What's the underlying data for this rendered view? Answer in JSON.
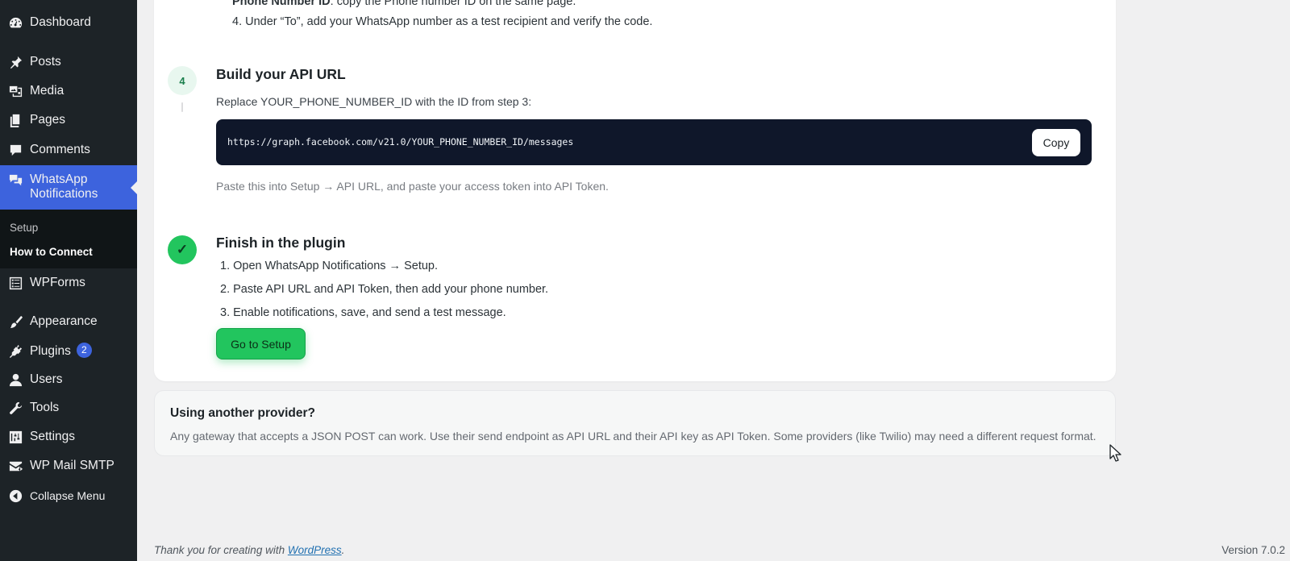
{
  "sidebar": {
    "items": [
      {
        "label": "Dashboard",
        "icon": "dashboard-icon"
      },
      {
        "label": "Posts",
        "icon": "pin-icon"
      },
      {
        "label": "Media",
        "icon": "media-icon"
      },
      {
        "label": "Pages",
        "icon": "pages-icon"
      },
      {
        "label": "Comments",
        "icon": "comment-icon"
      },
      {
        "label": "WhatsApp\nNotifications",
        "icon": "chat-bubbles-icon"
      },
      {
        "label": "WPForms",
        "icon": "form-icon"
      },
      {
        "label": "Appearance",
        "icon": "brush-icon"
      },
      {
        "label": "Plugins",
        "icon": "plug-icon",
        "badge": "2"
      },
      {
        "label": "Users",
        "icon": "user-icon"
      },
      {
        "label": "Tools",
        "icon": "wrench-icon"
      },
      {
        "label": "Settings",
        "icon": "settings-sliders-icon"
      },
      {
        "label": "WP Mail SMTP",
        "icon": "mail-icon"
      },
      {
        "label": "Collapse Menu",
        "icon": "collapse-arrow-icon"
      }
    ],
    "submenu": {
      "setup": "Setup",
      "how_to_connect": "How to Connect"
    }
  },
  "step3": {
    "item3_label": "Phone Number ID",
    "item3_text": ": copy the Phone number ID on the same page.",
    "item4": "4. Under “To”, add your WhatsApp number as a test recipient and verify the code."
  },
  "step4": {
    "number": "4",
    "title": "Build your API URL",
    "desc": "Replace YOUR_PHONE_NUMBER_ID with the ID from step 3:",
    "url": "https://graph.facebook.com/v21.0/YOUR_PHONE_NUMBER_ID/messages",
    "copy_label": "Copy",
    "note": "Paste this into Setup → API URL, and paste your access token into API Token."
  },
  "step5": {
    "check": "✓",
    "title": "Finish in the plugin",
    "items": [
      "1. Open WhatsApp Notifications → Setup.",
      "2. Paste API URL and API Token, then add your phone number.",
      "3. Enable notifications, save, and send a test message."
    ],
    "button_label": "Go to Setup"
  },
  "provider": {
    "title": "Using another provider?",
    "text": "Any gateway that accepts a JSON POST can work. Use their send endpoint as API URL and their API key as API Token. Some providers (like Twilio) may need a different request format."
  },
  "footer": {
    "thanks_prefix": "Thank you for creating with ",
    "link": "WordPress",
    "thanks_suffix": ".",
    "version": "Version 7.0.2"
  },
  "colors": {
    "sidebar_bg": "#1d2327",
    "active_menu": "#3d63dd",
    "green": "#22c55e",
    "code_bg": "#0f172a"
  }
}
